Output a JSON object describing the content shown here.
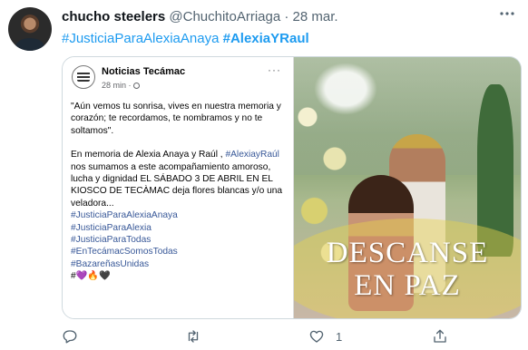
{
  "tweet": {
    "display_name": "chucho steelers",
    "handle": "@ChuchitoArriaga",
    "separator": "·",
    "date": "28 mar.",
    "hashtags": [
      "#JusticiaParaAlexiaAnaya",
      "#AlexiaYRaul"
    ],
    "actions": {
      "like_count": "1"
    }
  },
  "embedded_post": {
    "page_name": "Noticias Tecámac",
    "time": "28 min ·",
    "more": "···",
    "paragraph1": "\"Aún vemos tu sonrisa, vives en nuestra memoria y corazón; te recordamos, te nombramos y no te soltamos\".",
    "p2_intro": "En memoria de Alexia Anaya y Raúl ,",
    "p2_hashtag": "#AlexiayRaúl",
    "p2_rest": " nos sumamos a este acompañamiento amoroso, lucha y dignidad EL SÁBADO 3 DE ABRIL EN EL KIOSCO DE TECÀMAC deja flores blancas y/o una veladora...",
    "hashtags": [
      "#JusticiaParaAlexiaAnaya",
      "#JusticiaParaAlexia",
      "#JusticiaParaTodas",
      "#EnTecámacSomosTodas",
      "#BazareñasUnidas"
    ],
    "emoji_hash": "#",
    "emoji_purple": "💜",
    "emoji_fire": "🔥",
    "emoji_black": "🖤"
  },
  "photo": {
    "caption_line1": "DESCANSE",
    "caption_line2": "EN PAZ"
  }
}
